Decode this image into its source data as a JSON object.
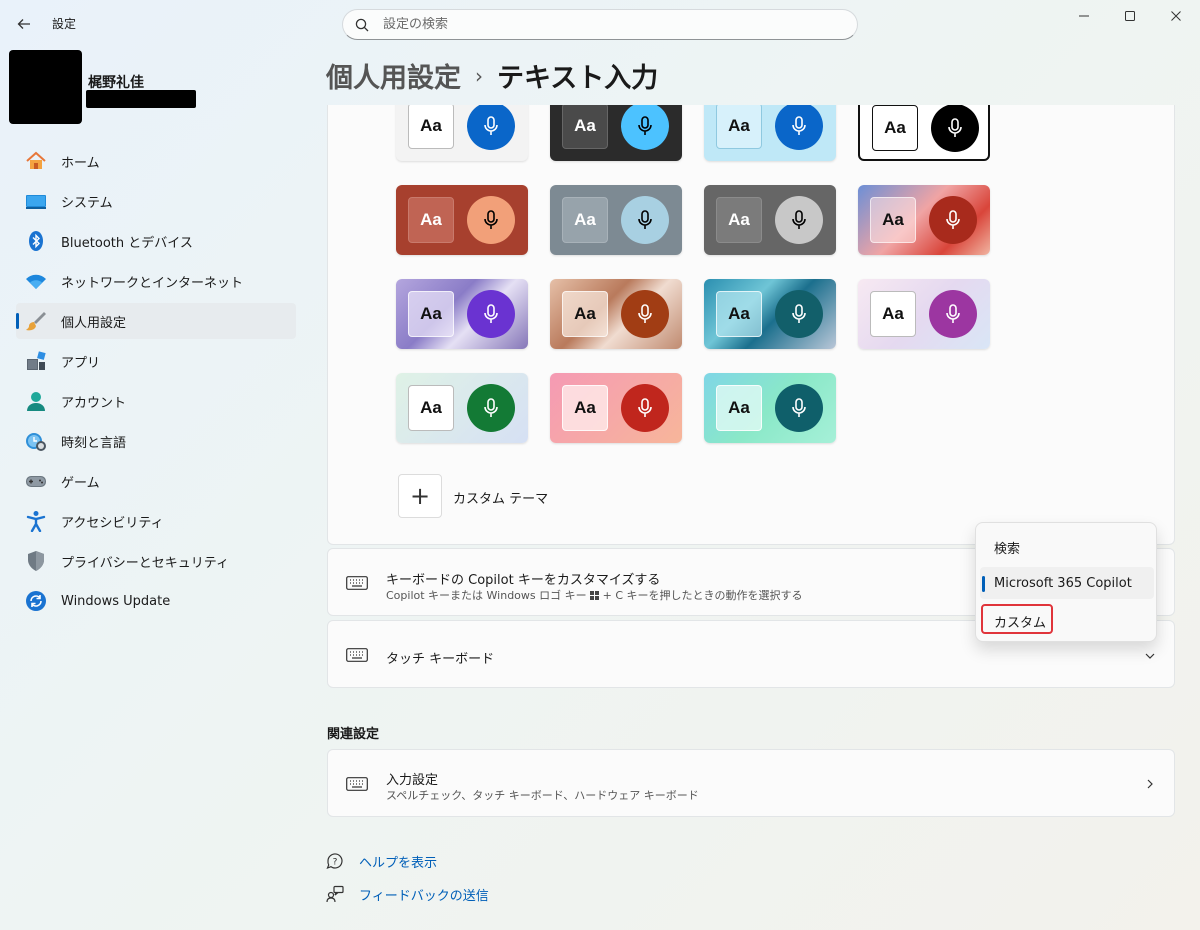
{
  "window": {
    "title": "設定"
  },
  "search": {
    "placeholder": "設定の検索"
  },
  "profile": {
    "name": "梶野礼佳",
    "email": ""
  },
  "sidebar": {
    "items": [
      {
        "label": "ホーム",
        "icon": "home-icon"
      },
      {
        "label": "システム",
        "icon": "system-icon"
      },
      {
        "label": "Bluetooth とデバイス",
        "icon": "bluetooth-icon"
      },
      {
        "label": "ネットワークとインターネット",
        "icon": "wifi-icon"
      },
      {
        "label": "個人用設定",
        "icon": "brush-icon",
        "active": true
      },
      {
        "label": "アプリ",
        "icon": "apps-icon"
      },
      {
        "label": "アカウント",
        "icon": "account-icon"
      },
      {
        "label": "時刻と言語",
        "icon": "time-language-icon"
      },
      {
        "label": "ゲーム",
        "icon": "gamepad-icon"
      },
      {
        "label": "アクセシビリティ",
        "icon": "accessibility-icon"
      },
      {
        "label": "プライバシーとセキュリティ",
        "icon": "shield-icon"
      },
      {
        "label": "Windows Update",
        "icon": "update-icon"
      }
    ]
  },
  "header": {
    "parent": "個人用設定",
    "separator": "›",
    "current": "テキスト入力"
  },
  "themes": {
    "aa_label": "Aa",
    "custom_label": "カスタム テーマ",
    "custom_plus": "+"
  },
  "copilot": {
    "title": "キーボードの Copilot キーをカスタマイズする",
    "subtitle_prefix": "Copilot キーまたは Windows ロゴ キー ",
    "subtitle_suffix": " + C キーを押したときの動作を選択する"
  },
  "flyout": {
    "options": [
      {
        "label": "検索"
      },
      {
        "label": "Microsoft 365 Copilot",
        "selected": true
      },
      {
        "label": "カスタム",
        "highlighted": true
      }
    ]
  },
  "touch_keyboard": {
    "title": "タッチ キーボード"
  },
  "related": {
    "section_title": "関連設定",
    "input_settings": {
      "title": "入力設定",
      "subtitle": "スペルチェック、タッチ キーボード、ハードウェア キーボード"
    }
  },
  "links": {
    "help": "ヘルプを表示",
    "feedback": "フィードバックの送信"
  },
  "colors": {
    "accent": "#005fb8",
    "highlight": "#e0343b"
  }
}
